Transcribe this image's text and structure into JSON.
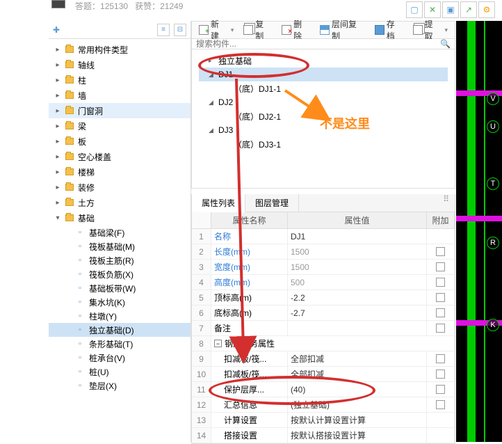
{
  "meta": {
    "label_answers": "答题：",
    "answers": "125130",
    "label_likes": "获赞：",
    "likes": "21249"
  },
  "left_tree": [
    {
      "label": "常用构件类型"
    },
    {
      "label": "轴线"
    },
    {
      "label": "柱"
    },
    {
      "label": "墙"
    },
    {
      "label": "门窗洞",
      "selected": true
    },
    {
      "label": "梁"
    },
    {
      "label": "板"
    },
    {
      "label": "空心楼盖"
    },
    {
      "label": "楼梯"
    },
    {
      "label": "装修"
    },
    {
      "label": "土方"
    },
    {
      "label": "基础",
      "expanded": true,
      "children": [
        {
          "icon": "line",
          "label": "基础梁(F)"
        },
        {
          "icon": "grid",
          "label": "筏板基础(M)"
        },
        {
          "icon": "rebar",
          "label": "筏板主筋(R)"
        },
        {
          "icon": "rebar2",
          "label": "筏板负筋(X)"
        },
        {
          "icon": "slab",
          "label": "基础板带(W)"
        },
        {
          "icon": "pit",
          "label": "集水坑(K)"
        },
        {
          "icon": "col",
          "label": "柱墩(Y)"
        },
        {
          "icon": "iso",
          "label": "独立基础(D)",
          "selected": true
        },
        {
          "icon": "strip",
          "label": "条形基础(T)"
        },
        {
          "icon": "cap",
          "label": "桩承台(V)"
        },
        {
          "icon": "pile",
          "label": "桩(U)"
        },
        {
          "icon": "layer",
          "label": "垫层(X)"
        }
      ]
    }
  ],
  "toolbar": {
    "new": "新建",
    "copy": "复制",
    "delete": "删除",
    "layercopy": "层间复制",
    "archive": "存档",
    "submit": "提取"
  },
  "search_placeholder": "搜索构件...",
  "comp_tree": [
    {
      "d": 1,
      "exp": "▸",
      "label": "独立基础"
    },
    {
      "d": 1,
      "exp": "◢",
      "label": "DJ1",
      "sel": true
    },
    {
      "d": 3,
      "label": "（底）DJ1-1"
    },
    {
      "d": 1,
      "exp": "◢",
      "label": "DJ2"
    },
    {
      "d": 3,
      "label": "（底）DJ2-1"
    },
    {
      "d": 1,
      "exp": "◢",
      "label": "DJ3"
    },
    {
      "d": 3,
      "label": "（底）DJ3-1"
    }
  ],
  "tabs": {
    "prop": "属性列表",
    "layer": "图层管理"
  },
  "prop_header": {
    "name": "属性名称",
    "val": "属性值",
    "add": "附加"
  },
  "props": [
    {
      "n": "1",
      "name": "名称",
      "link": true,
      "val": "DJ1"
    },
    {
      "n": "2",
      "name": "长度(mm)",
      "link": true,
      "val": "1500",
      "grey": true,
      "cb": true
    },
    {
      "n": "3",
      "name": "宽度(mm)",
      "link": true,
      "val": "1500",
      "grey": true,
      "cb": true
    },
    {
      "n": "4",
      "name": "高度(mm)",
      "link": true,
      "val": "500",
      "grey": true,
      "cb": true
    },
    {
      "n": "5",
      "name": "顶标高(m)",
      "val": "-2.2",
      "cb": true
    },
    {
      "n": "6",
      "name": "底标高(m)",
      "val": "-2.7",
      "cb": true
    },
    {
      "n": "7",
      "name": "备注",
      "val": "",
      "cb": true
    },
    {
      "n": "8",
      "group": true,
      "name": "钢筋业务属性"
    },
    {
      "n": "9",
      "indent": true,
      "name": "扣减板/筏...",
      "val": "全部扣减",
      "cb": true
    },
    {
      "n": "10",
      "indent": true,
      "name": "扣减板/筏...",
      "val": "全部扣减",
      "cb": true
    },
    {
      "n": "11",
      "indent": true,
      "name": "保护层厚...",
      "val": "(40)",
      "cb": true
    },
    {
      "n": "12",
      "indent": true,
      "name": "汇总信息",
      "val": "(独立基础)",
      "cb": true
    },
    {
      "n": "13",
      "indent": true,
      "name": "计算设置",
      "val": "按默认计算设置计算"
    },
    {
      "n": "14",
      "indent": true,
      "name": "搭接设置",
      "val": "按默认搭接设置计算"
    }
  ],
  "right_badges": [
    "V",
    "U",
    "T",
    "R",
    "K"
  ],
  "annotation_text": "不是这里"
}
